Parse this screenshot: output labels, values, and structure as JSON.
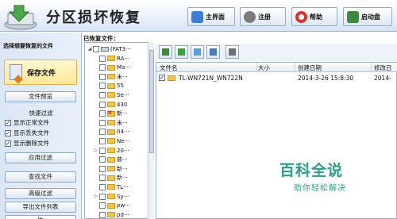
{
  "app": {
    "title": "分区损坏恢复"
  },
  "header_buttons": [
    {
      "label": "主界面",
      "icon": "home-icon",
      "color": "#3b7dd8"
    },
    {
      "label": "注册",
      "icon": "user-icon",
      "color": "#555555"
    },
    {
      "label": "帮助",
      "icon": "lifebuoy-icon",
      "color": "#d9342b"
    },
    {
      "label": "启动盘",
      "icon": "drive-icon",
      "color": "#3a8a3a"
    }
  ],
  "left_panel": {
    "title": "选择想要恢复的文件",
    "save_label": "保存文件",
    "preview_label": "文件预览",
    "filter_heading": "快速过滤",
    "filters": [
      {
        "label": "显示正常文件",
        "checked": true
      },
      {
        "label": "显示丢失文件",
        "checked": true
      },
      {
        "label": "显示删除文件",
        "checked": true
      }
    ],
    "apply_filter_label": "应用过滤",
    "find_label": "查找文件",
    "advanced_filter_label": "高级过滤",
    "export_label": "导出文件列表",
    "next_label": "恢"
  },
  "tree": {
    "label": "已恢复文件：",
    "root": "(FAT3···",
    "items": [
      {
        "text": "RA···",
        "marker": "",
        "deleted": false
      },
      {
        "text": "Ma···",
        "marker": "",
        "deleted": false
      },
      {
        "text": "未···",
        "marker": "",
        "deleted": false
      },
      {
        "text": "55",
        "marker": "",
        "deleted": false
      },
      {
        "text": "Se···",
        "marker": "",
        "deleted": false
      },
      {
        "text": "430",
        "marker": "",
        "deleted": false
      },
      {
        "text": "新···",
        "marker": "",
        "deleted": true
      },
      {
        "text": "未···",
        "marker": "",
        "deleted": false
      },
      {
        "text": "04···",
        "marker": "",
        "deleted": false
      },
      {
        "text": "Ne···",
        "marker": "",
        "deleted": false
      },
      {
        "text": "20···",
        "marker": "▷",
        "deleted": false
      },
      {
        "text": "普···",
        "marker": "",
        "deleted": false
      },
      {
        "text": "新···",
        "marker": "",
        "deleted": false
      },
      {
        "text": "新···",
        "marker": "",
        "deleted": false
      },
      {
        "text": "TL···",
        "marker": "",
        "deleted": false
      },
      {
        "text": "Sy···",
        "marker": "▷",
        "deleted": false
      },
      {
        "text": "pw···",
        "marker": "",
        "deleted": false
      },
      {
        "text": "pd···",
        "marker": "",
        "deleted": false
      }
    ]
  },
  "toolbar_icons": [
    "up-folder-icon",
    "add-icon",
    "image-view-icon",
    "details-view-icon",
    "save-disk-icon"
  ],
  "grid": {
    "columns": [
      "文件名",
      "大小",
      "创建日期",
      "修改日"
    ],
    "rows": [
      {
        "name": "TL-WN721N_WN722N",
        "size": "",
        "created": "2014-3-26 15:8:30",
        "modified": "2014-"
      }
    ]
  },
  "watermark": {
    "main": "百科全说",
    "sub": "助你轻松解决"
  }
}
